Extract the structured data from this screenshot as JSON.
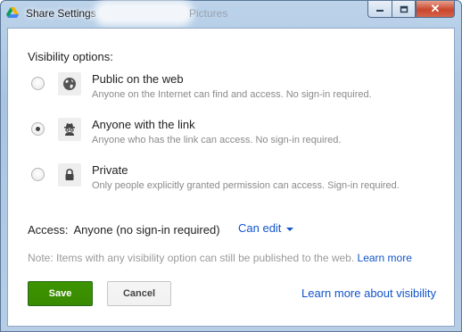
{
  "window": {
    "title": "Share Settings",
    "title_suffix": "Pictures",
    "controls": {
      "minimize_icon": "minimize-icon",
      "maximize_icon": "maximize-icon",
      "close_icon": "close-icon",
      "close_glyph": "✕"
    }
  },
  "dialog": {
    "visibility_label": "Visibility options:",
    "options": [
      {
        "title": "Public on the web",
        "description": "Anyone on the Internet can find and access. No sign-in required.",
        "icon": "globe-icon",
        "selected": false
      },
      {
        "title": "Anyone with the link",
        "description": "Anyone who has the link can access. No sign-in required.",
        "icon": "incognito-user-icon",
        "selected": true
      },
      {
        "title": "Private",
        "description": "Only people explicitly granted permission can access. Sign-in required.",
        "icon": "lock-icon",
        "selected": false
      }
    ],
    "access": {
      "label": "Access:",
      "value": "Anyone (no sign-in required)",
      "permission": "Can edit"
    },
    "note": {
      "text": "Note: Items with any visibility option can still be published to the web.",
      "link": "Learn more"
    },
    "buttons": {
      "save": "Save",
      "cancel": "Cancel"
    },
    "learn_more_visibility": "Learn more about visibility"
  },
  "colors": {
    "accent_link": "#1155cc",
    "save_button": "#3d9400",
    "close_button": "#c9462c"
  }
}
